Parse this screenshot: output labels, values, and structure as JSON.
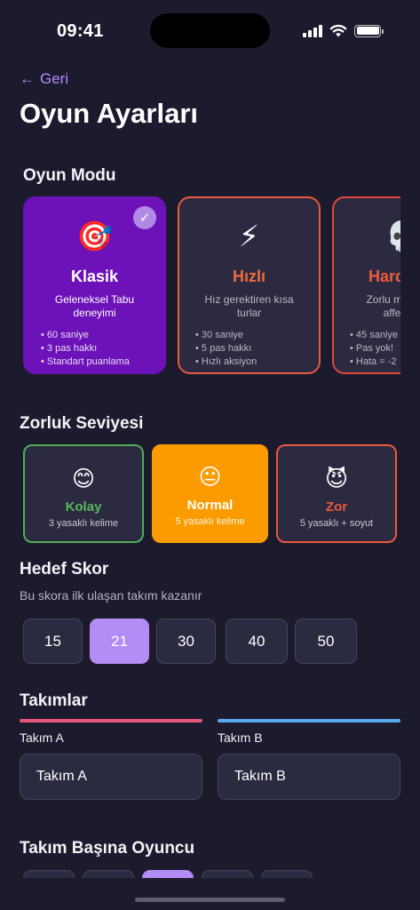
{
  "status": {
    "time": "09:41"
  },
  "header": {
    "back_label": "Geri",
    "title": "Oyun Ayarları"
  },
  "game_mode": {
    "title": "Oyun Modu",
    "cards": [
      {
        "emoji": "🎯",
        "name": "Klasik",
        "desc": "Geleneksel Tabu deneyimi",
        "bullets": [
          "60 saniye",
          "3 pas hakkı",
          "Standart puanlama"
        ],
        "color": "#ffffff",
        "selected": true
      },
      {
        "emoji": "⚡",
        "name": "Hızlı",
        "desc": "Hız gerektiren kısa turlar",
        "bullets": [
          "30 saniye",
          "5 pas hakkı",
          "Hızlı aksiyon"
        ],
        "color": "#f06a3c",
        "selected": false
      },
      {
        "emoji": "💀",
        "name": "Hardcore",
        "desc": "Zorlu mod, hata affetmez",
        "bullets": [
          "45 saniye",
          "Pas yok!",
          "Hata = -2"
        ],
        "color": "#ef5a3c",
        "selected": false
      }
    ]
  },
  "difficulty": {
    "title": "Zorluk Seviyesi",
    "options": [
      {
        "emoji": "😊",
        "name": "Kolay",
        "sub": "3 yasaklı kelime",
        "color": "#56b85a",
        "selected": false
      },
      {
        "emoji": "😐",
        "name": "Normal",
        "sub": "5 yasaklı kelime",
        "color": "#ffffff",
        "selected": true
      },
      {
        "emoji": "😈",
        "name": "Zor",
        "sub": "5 yasaklı + soyut",
        "color": "#ef5a3c",
        "selected": false
      }
    ]
  },
  "target_score": {
    "title": "Hedef Skor",
    "hint": "Bu skora ilk ulaşan takım kazanır",
    "options": [
      "15",
      "21",
      "30",
      "40",
      "50"
    ],
    "selected": "21"
  },
  "teams": {
    "title": "Takımlar",
    "team_a": {
      "label": "Takım A",
      "value": "Takım A",
      "color": "#e8557a"
    },
    "team_b": {
      "label": "Takım B",
      "value": "Takım B",
      "color": "#5aa8f0"
    }
  },
  "players_per_team": {
    "title": "Takım Başına Oyuncu",
    "option_count": 5,
    "selected_index": 2
  }
}
